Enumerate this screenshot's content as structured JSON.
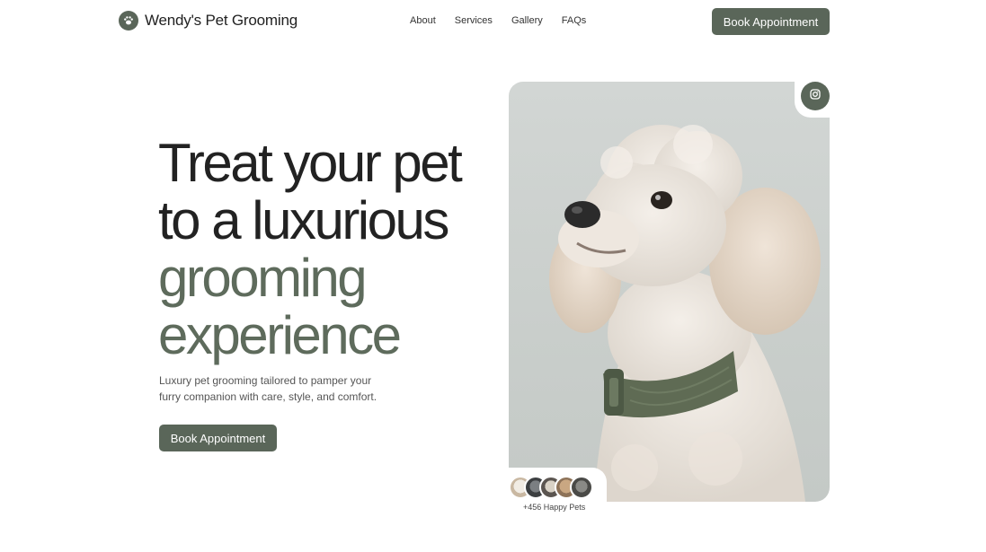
{
  "brand": {
    "name": "Wendy's Pet Grooming",
    "logo_icon": "paw-icon"
  },
  "nav": {
    "links": [
      "About",
      "Services",
      "Gallery",
      "FAQs"
    ],
    "cta_label": "Book Appointment"
  },
  "hero": {
    "title_line1": "Treat your pet",
    "title_line2": "to a luxurious",
    "title_line3": "grooming",
    "title_line4": "experience",
    "subtitle": "Luxury pet grooming tailored to pamper your furry companion with care, style, and comfort.",
    "cta_label": "Book Appointment"
  },
  "social": {
    "icon": "instagram-icon",
    "happy_pets": "+456 Happy Pets"
  },
  "colors": {
    "accent": "#5a6659",
    "accent_text": "#5e6b5c",
    "dark_text": "#222222",
    "background": "#ffffff"
  }
}
